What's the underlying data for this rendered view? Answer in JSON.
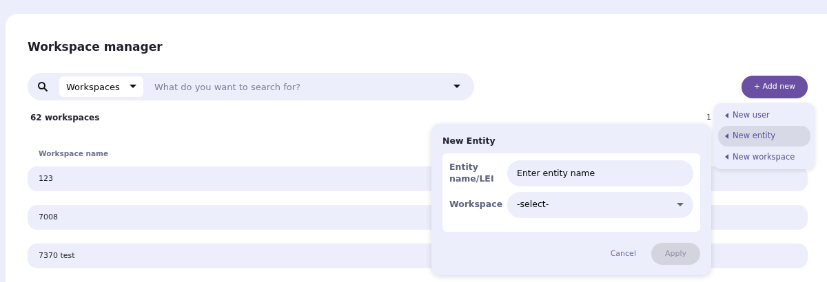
{
  "page": {
    "title": "Workspace manager"
  },
  "search": {
    "scope": "Workspaces",
    "placeholder": "What do you want to search for?"
  },
  "add_button": {
    "label": "+ Add new"
  },
  "summary": {
    "count": "62 workspaces",
    "page_info": "1"
  },
  "table": {
    "columns": [
      "Workspace name"
    ],
    "rows": [
      {
        "name": "123"
      },
      {
        "name": "7008"
      },
      {
        "name": "7370 test"
      }
    ]
  },
  "add_menu": {
    "items": [
      {
        "label": "New user",
        "selected": false
      },
      {
        "label": "New entity",
        "selected": true
      },
      {
        "label": "New workspace",
        "selected": false
      }
    ]
  },
  "dialog": {
    "title": "New Entity",
    "fields": [
      {
        "kind": "text",
        "label": "Entity name/LEI",
        "value": "Enter entity name"
      },
      {
        "kind": "select",
        "label": "Workspace",
        "value": "-select-"
      }
    ],
    "buttons": [
      {
        "kind": "link",
        "label": "Cancel"
      },
      {
        "kind": "primary",
        "label": "Apply",
        "disabled": true
      }
    ]
  }
}
